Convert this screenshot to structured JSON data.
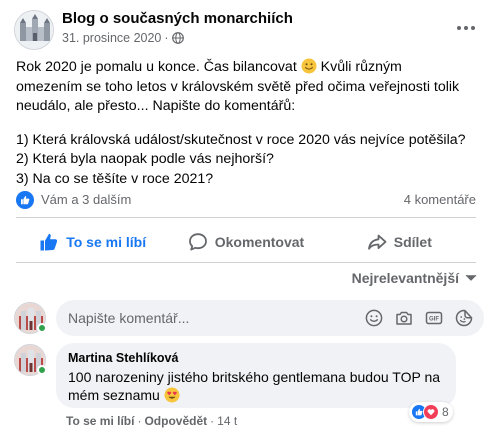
{
  "post": {
    "page_name": "Blog o současných monarchiích",
    "date": "31. prosince 2020",
    "meta_separator": "·",
    "lines": [
      "Rok 2020 je pomalu u konce. Čas bilancovat",
      "omezením se toho letos v královském světě před očima veřejnosti tolik",
      "neudálo, ale přesto... Napište do komentářů:",
      "1) Která královská událost/skutečnost v roce 2020 vás nejvíce potěšila?",
      "2) Která byla naopak podle vás nejhorší?",
      "3) Na co se těšíte v roce 2021?"
    ],
    "line1_tail": "Kvůli různým",
    "emoji_name": "slightly-smiling-face-emoji"
  },
  "reactions": {
    "text": "Vám a 3 dalším",
    "comments": "4 komentáře"
  },
  "actions": {
    "like": "To se mi líbí",
    "comment": "Okomentovat",
    "share": "Sdílet"
  },
  "sort": {
    "label": "Nejrelevantnější"
  },
  "composer": {
    "placeholder": "Napište komentář..."
  },
  "comment": {
    "author": "Martina Stehlíková",
    "text": "100 narozeniny jistého britského gentlemana budou TOP na mém seznamu",
    "emoji_name": "heart-eyes-emoji",
    "reaction_count": "8",
    "like_label": "To se mi líbí",
    "reply_label": "Odpovědět",
    "time": "14 t",
    "separator": "·"
  },
  "colors": {
    "accent": "#1877f2",
    "secondary_text": "#65676b",
    "bubble": "#f0f2f5",
    "love": "#f33e58",
    "online": "#31a24c"
  }
}
